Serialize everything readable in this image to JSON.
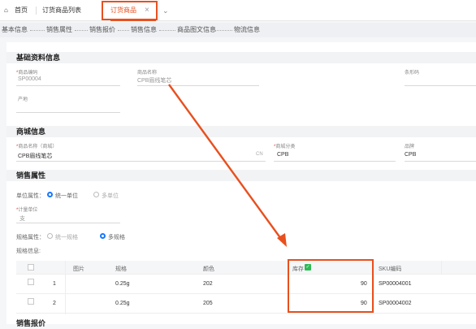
{
  "tabs": {
    "home": "首页",
    "order_list": "订货商品列表",
    "active": "订货商品",
    "close": "×",
    "more": "⌄"
  },
  "steps": [
    "基本信息",
    "销售属性",
    "销售报价",
    "销售信息",
    "商品图文信息",
    "物流信息"
  ],
  "basic": {
    "title": "基础资料信息",
    "code_label": "商品编码",
    "code_value": "SP00004",
    "name_label": "商品名称",
    "name_value": "CPB眉线笔芯",
    "barcode_label": "条形码",
    "origin_label": "产地"
  },
  "mall": {
    "title": "商城信息",
    "name_label": "商品名称（商城）",
    "name_value": "CPB眉线笔芯",
    "lang": "CN",
    "category_label": "商城分类",
    "category_value": "CPB",
    "brand_label": "品牌",
    "brand_value": "CPB"
  },
  "sales": {
    "title": "销售属性",
    "unit_attr_label": "单位属性：",
    "unit_single": "统一单位",
    "unit_multi": "多单位",
    "measure_label": "计量单位",
    "measure_value": "支",
    "spec_attr_label": "规格属性：",
    "spec_single": "统一规格",
    "spec_multi": "多规格",
    "spec_info_label": "规格信息:"
  },
  "table": {
    "headers": {
      "image": "图片",
      "spec": "规格",
      "color": "颜色",
      "stock": "库存",
      "sku": "SKU编码"
    },
    "rows": [
      {
        "idx": "1",
        "spec": "0.25g",
        "color": "202",
        "stock": "90",
        "sku": "SP00004001"
      },
      {
        "idx": "2",
        "spec": "0.25g",
        "color": "205",
        "stock": "90",
        "sku": "SP00004002"
      }
    ]
  },
  "next_section_title": "销售报价",
  "colors": {
    "accent": "#1677ff",
    "highlight": "#e8501e",
    "tab_active": "#e8501e"
  }
}
